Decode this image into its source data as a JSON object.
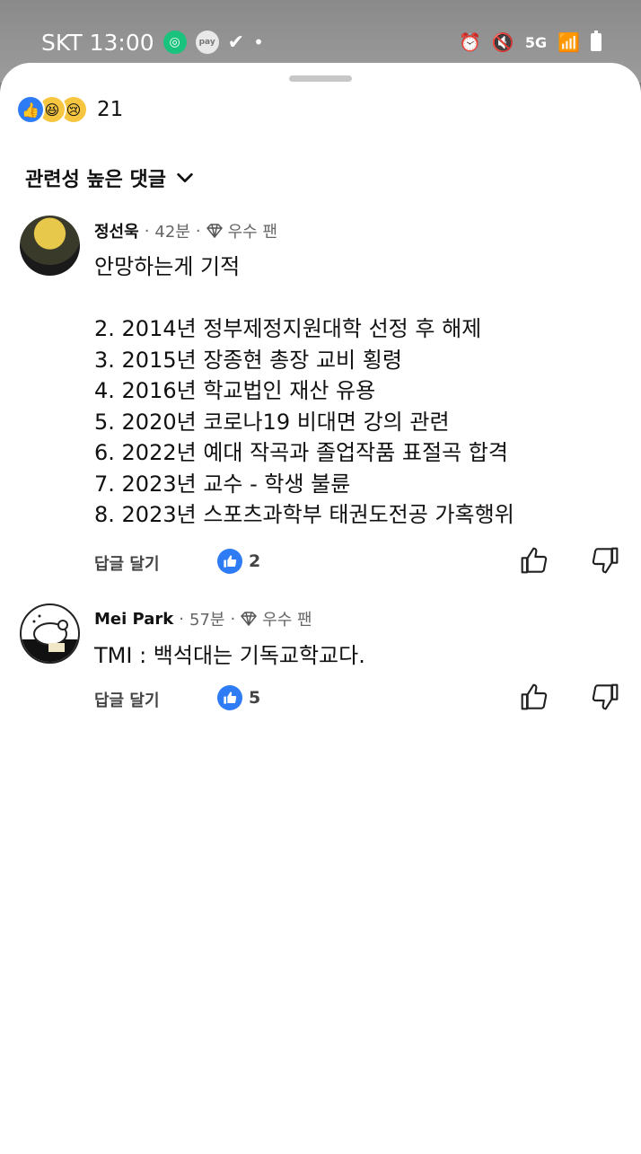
{
  "status_bar": {
    "carrier": "SKT",
    "time": "13:00",
    "pay_label": "pay",
    "network": "5G"
  },
  "reactions": {
    "count": "21",
    "icons": [
      "like-icon",
      "haha-icon",
      "sad-icon"
    ]
  },
  "sort": {
    "label": "관련성 높은 댓글"
  },
  "comments": [
    {
      "author": "정선욱",
      "time": "42분",
      "badge": "우수 팬",
      "text": "안망하는게 기적\n\n2. 2014년 정부제정지원대학 선정 후 해제\n3. 2015년 장종현 총장 교비 횡령\n4. 2016년 학교법인 재산 유용\n5. 2020년 코로나19 비대면 강의 관련\n6. 2022년 예대 작곡과 졸업작품 표절곡 합격\n7. 2023년 교수 - 학생 불륜\n8. 2023년 스포츠과학부 태권도전공 가혹행위",
      "reply_label": "답글 달기",
      "likes": "2"
    },
    {
      "author": "Mei Park",
      "time": "57분",
      "badge": "우수 팬",
      "text": "TMI : 백석대는 기독교학교다.",
      "reply_label": "답글 달기",
      "likes": "5"
    }
  ],
  "colors": {
    "accent": "#2d7cf6",
    "status_bar": "#8a8a8a"
  }
}
